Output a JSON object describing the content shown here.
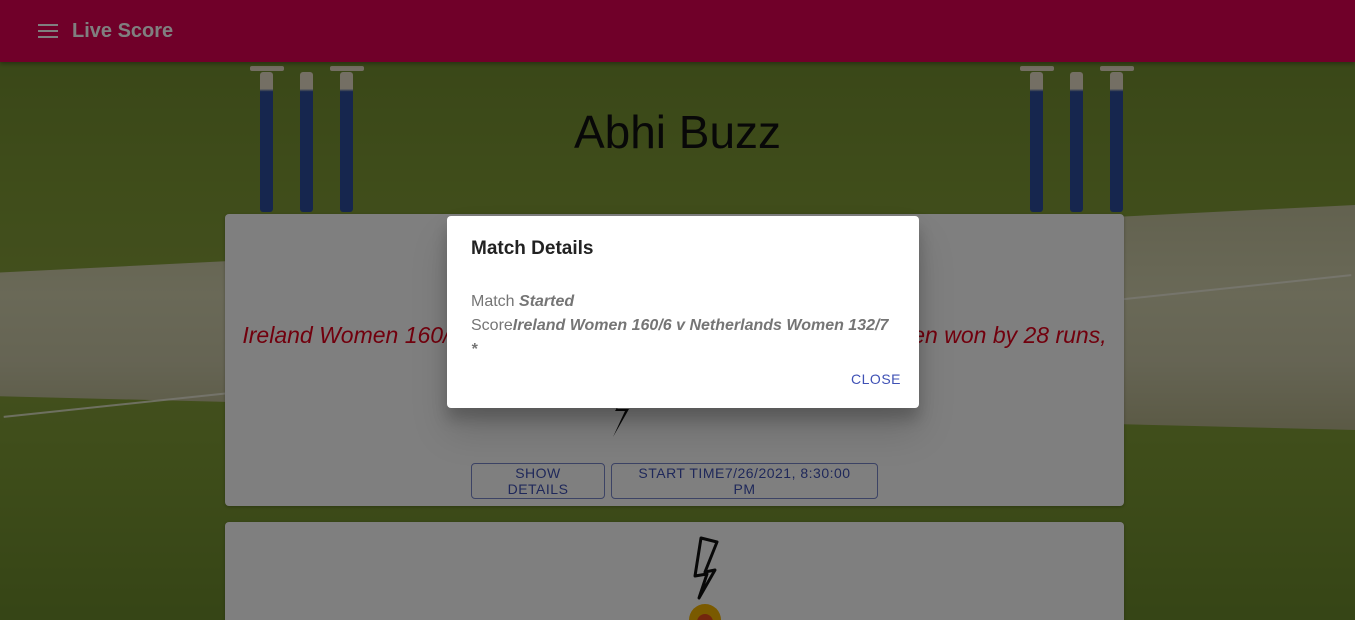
{
  "appbar": {
    "title": "Live Score"
  },
  "page": {
    "heading": "Abhi Buzz"
  },
  "card1": {
    "match_text": "Ireland Women 160/6 v Netherlands Women 132/7 * Ireland Women won by 28 runs, Netherlands Women",
    "show_details_label": "SHOW DETAILS",
    "start_time_label": "START TIME7/26/2021, 8:30:00 PM"
  },
  "dialog": {
    "title": "Match Details",
    "match_label": "Match",
    "match_value": "Started",
    "score_label": "Score",
    "score_value": "Ireland Women 160/6 v Netherlands Women 132/7 *",
    "close_label": "CLOSE"
  },
  "colors": {
    "appbar": "#e10052",
    "accent": "#3f51b5",
    "match_text": "#e3001b"
  },
  "icons": {
    "menu": "menu-icon",
    "bolt": "lightning-bolt-icon"
  }
}
